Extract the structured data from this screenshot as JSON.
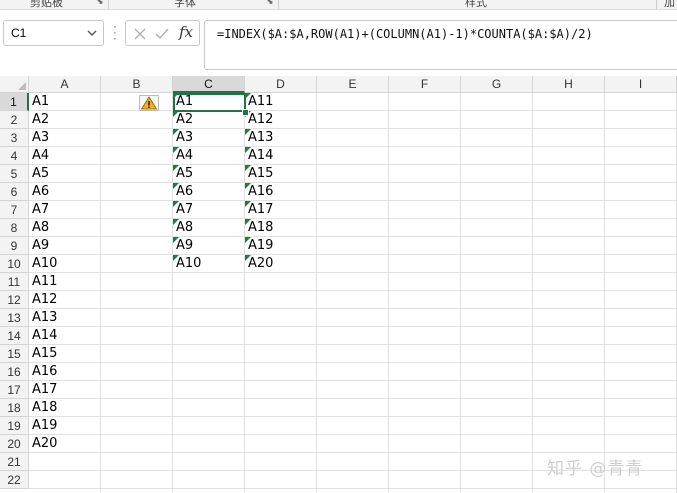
{
  "ribbon": {
    "groups": [
      {
        "label": "剪贴板"
      },
      {
        "label": "字体"
      },
      {
        "label": "样式"
      },
      {
        "label": "加"
      }
    ]
  },
  "formula_bar": {
    "name_box": "C1",
    "formula": "=INDEX($A:$A,ROW(A1)+(COLUMN(A1)-1)*COUNTA($A:$A)/2)",
    "fx_label": "fx"
  },
  "columns": [
    "A",
    "B",
    "C",
    "D",
    "E",
    "F",
    "G",
    "H",
    "I"
  ],
  "rows": [
    "1",
    "2",
    "3",
    "4",
    "5",
    "6",
    "7",
    "8",
    "9",
    "10",
    "11",
    "12",
    "13",
    "14",
    "15",
    "16",
    "17",
    "18",
    "19",
    "20",
    "21",
    "22"
  ],
  "col_a": [
    "A1",
    "A2",
    "A3",
    "A4",
    "A5",
    "A6",
    "A7",
    "A8",
    "A9",
    "A10",
    "A11",
    "A12",
    "A13",
    "A14",
    "A15",
    "A16",
    "A17",
    "A18",
    "A19",
    "A20"
  ],
  "col_c": [
    "A1",
    "A2",
    "A3",
    "A4",
    "A5",
    "A6",
    "A7",
    "A8",
    "A9",
    "A10"
  ],
  "col_d": [
    "A11",
    "A12",
    "A13",
    "A14",
    "A15",
    "A16",
    "A17",
    "A18",
    "A19",
    "A20"
  ],
  "selected_cell": "C1",
  "watermark": "知乎 @青青",
  "colors": {
    "accent": "#217346",
    "error_indicator": "#1f7a3e",
    "grid_line": "#e1e1e1",
    "header_bg": "#f3f3f3",
    "warning": "#f2b01e"
  },
  "icons": {
    "warning": "warning-icon",
    "cancel": "cancel-icon",
    "confirm": "check-icon",
    "name_box_dropdown": "chevron-down-icon"
  }
}
